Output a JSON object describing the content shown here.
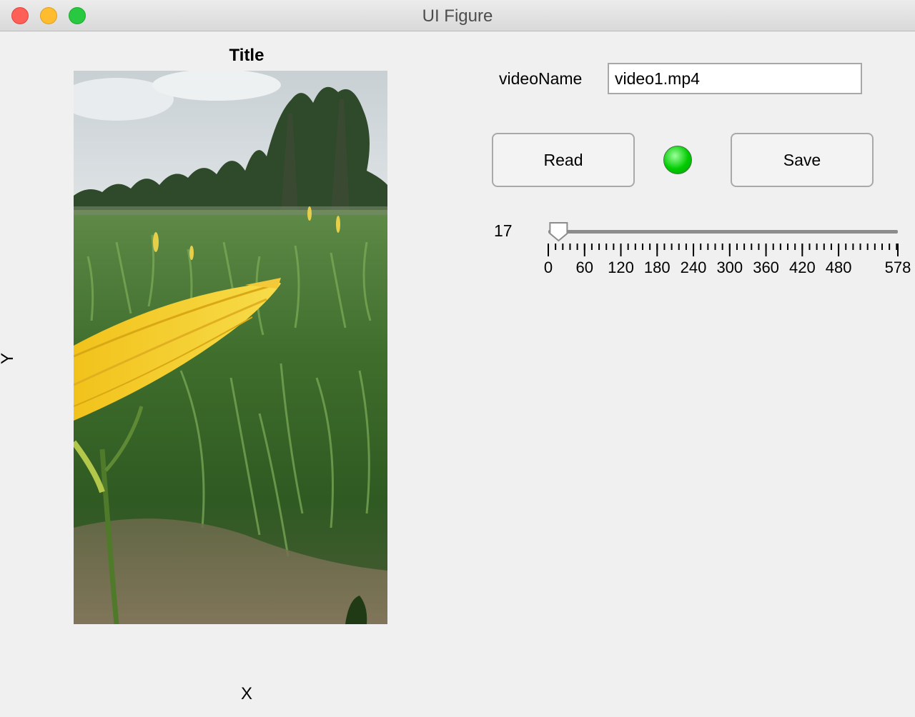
{
  "window": {
    "title": "UI Figure"
  },
  "axes": {
    "title": "Title",
    "xlabel": "X",
    "ylabel": "Y"
  },
  "video_name": {
    "label": "videoName",
    "value": "video1.mp4"
  },
  "buttons": {
    "read": "Read",
    "save": "Save"
  },
  "lamp": {
    "color": "#00cc00",
    "status": "on"
  },
  "slider": {
    "value": 17,
    "value_text": "17",
    "min": 0,
    "max": 578,
    "major_ticks": [
      0,
      60,
      120,
      180,
      240,
      300,
      360,
      420,
      480,
      578
    ],
    "major_tick_labels": [
      "0",
      "60",
      "120",
      "180",
      "240",
      "300",
      "360",
      "420",
      "480",
      "578"
    ],
    "minor_step": 12
  },
  "colors": {
    "background": "#f0f0f0",
    "lamp_green": "#00cc00"
  }
}
